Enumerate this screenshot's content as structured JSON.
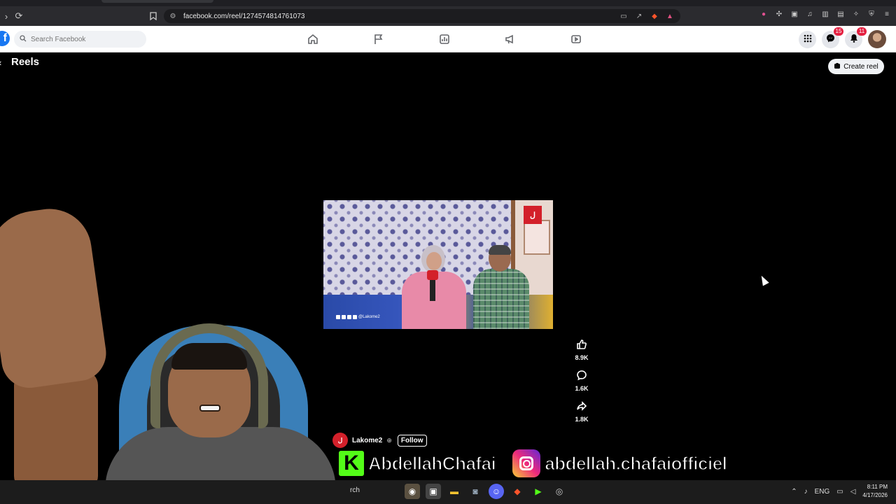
{
  "browser": {
    "url": "facebook.com/reel/1274574814761073"
  },
  "fb": {
    "search_placeholder": "Search Facebook",
    "messenger_badge": "15",
    "notifications_badge": "11"
  },
  "reels": {
    "title": "Reels",
    "create_label": "Create reel"
  },
  "video": {
    "channel_logo_text": "ل",
    "watermark_text": "@Lakome2"
  },
  "actions": {
    "like_count": "8.9K",
    "comment_count": "1.6K",
    "share_count": "1.8K"
  },
  "channel": {
    "name": "Lakome2",
    "follow_label": "Follow"
  },
  "overlay": {
    "kick_name": "AbdellahChafai",
    "instagram_name": "abdellah.chafaiofficiel"
  },
  "taskbar": {
    "search_text": "rch",
    "lang": "ENG",
    "time": "8:11 PM",
    "date": "4/17/2026"
  },
  "icons": [
    "reload-icon",
    "bookmark-icon",
    "home-icon",
    "flag-icon",
    "marketplace-icon",
    "megaphone-icon",
    "video-icon",
    "grid-menu-icon",
    "messenger-icon",
    "bell-icon",
    "like-icon",
    "comment-icon",
    "share-icon"
  ]
}
